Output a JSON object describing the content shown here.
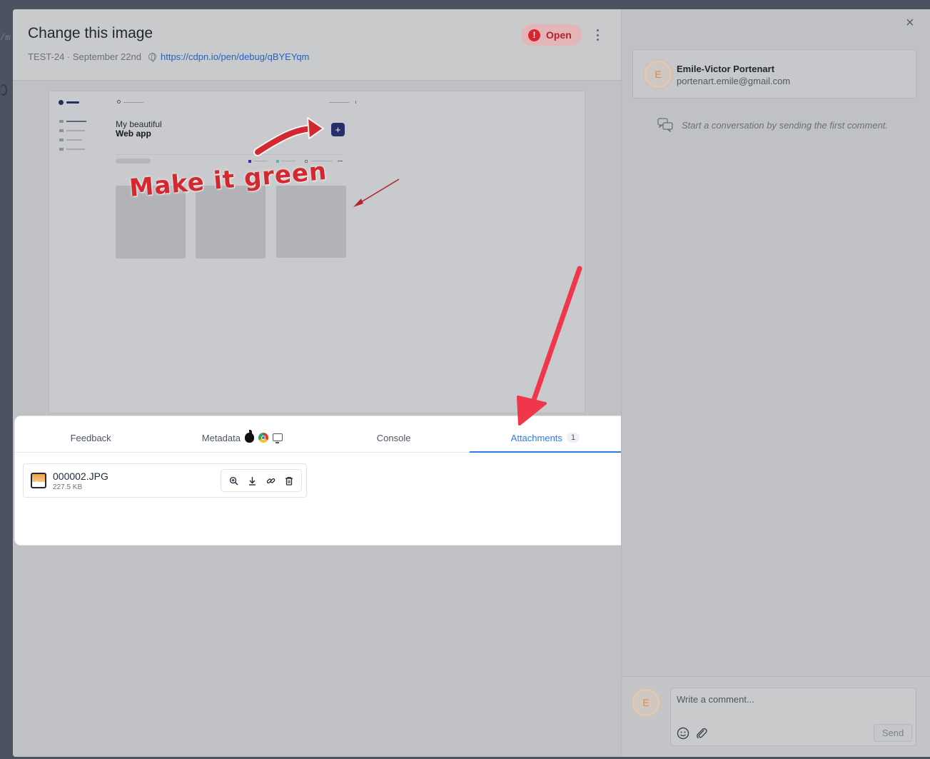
{
  "background": {
    "fragment": "/m"
  },
  "modal": {
    "title": "Change this image",
    "meta": {
      "id_date": "TEST-24 · September 22nd",
      "url": "https://cdpn.io/pen/debug/qBYEYqm"
    },
    "status": {
      "label": "Open",
      "icon": "!"
    },
    "preview": {
      "title_line1": "My beautiful",
      "title_line2": "Web app",
      "plus": "+",
      "annotation": "Make it green"
    },
    "tabs": [
      {
        "label": "Feedback"
      },
      {
        "label": "Metadata"
      },
      {
        "label": "Console"
      },
      {
        "label": "Attachments",
        "count": "1"
      }
    ],
    "attachment": {
      "name": "000002.JPG",
      "size": "227.5 KB"
    }
  },
  "sidebar": {
    "close": "×",
    "user": {
      "initial": "E",
      "name": "Emile-Victor Portenart",
      "email": "portenart.emile@gmail.com"
    },
    "empty_message": "Start a conversation by sending the first comment.",
    "composer": {
      "initial": "E",
      "placeholder": "Write a comment...",
      "send_label": "Send"
    }
  },
  "colors": {
    "accent": "#2b7be4",
    "status": "#d7262f",
    "annotation": "#d3282f",
    "arrow": "#f0364a"
  }
}
